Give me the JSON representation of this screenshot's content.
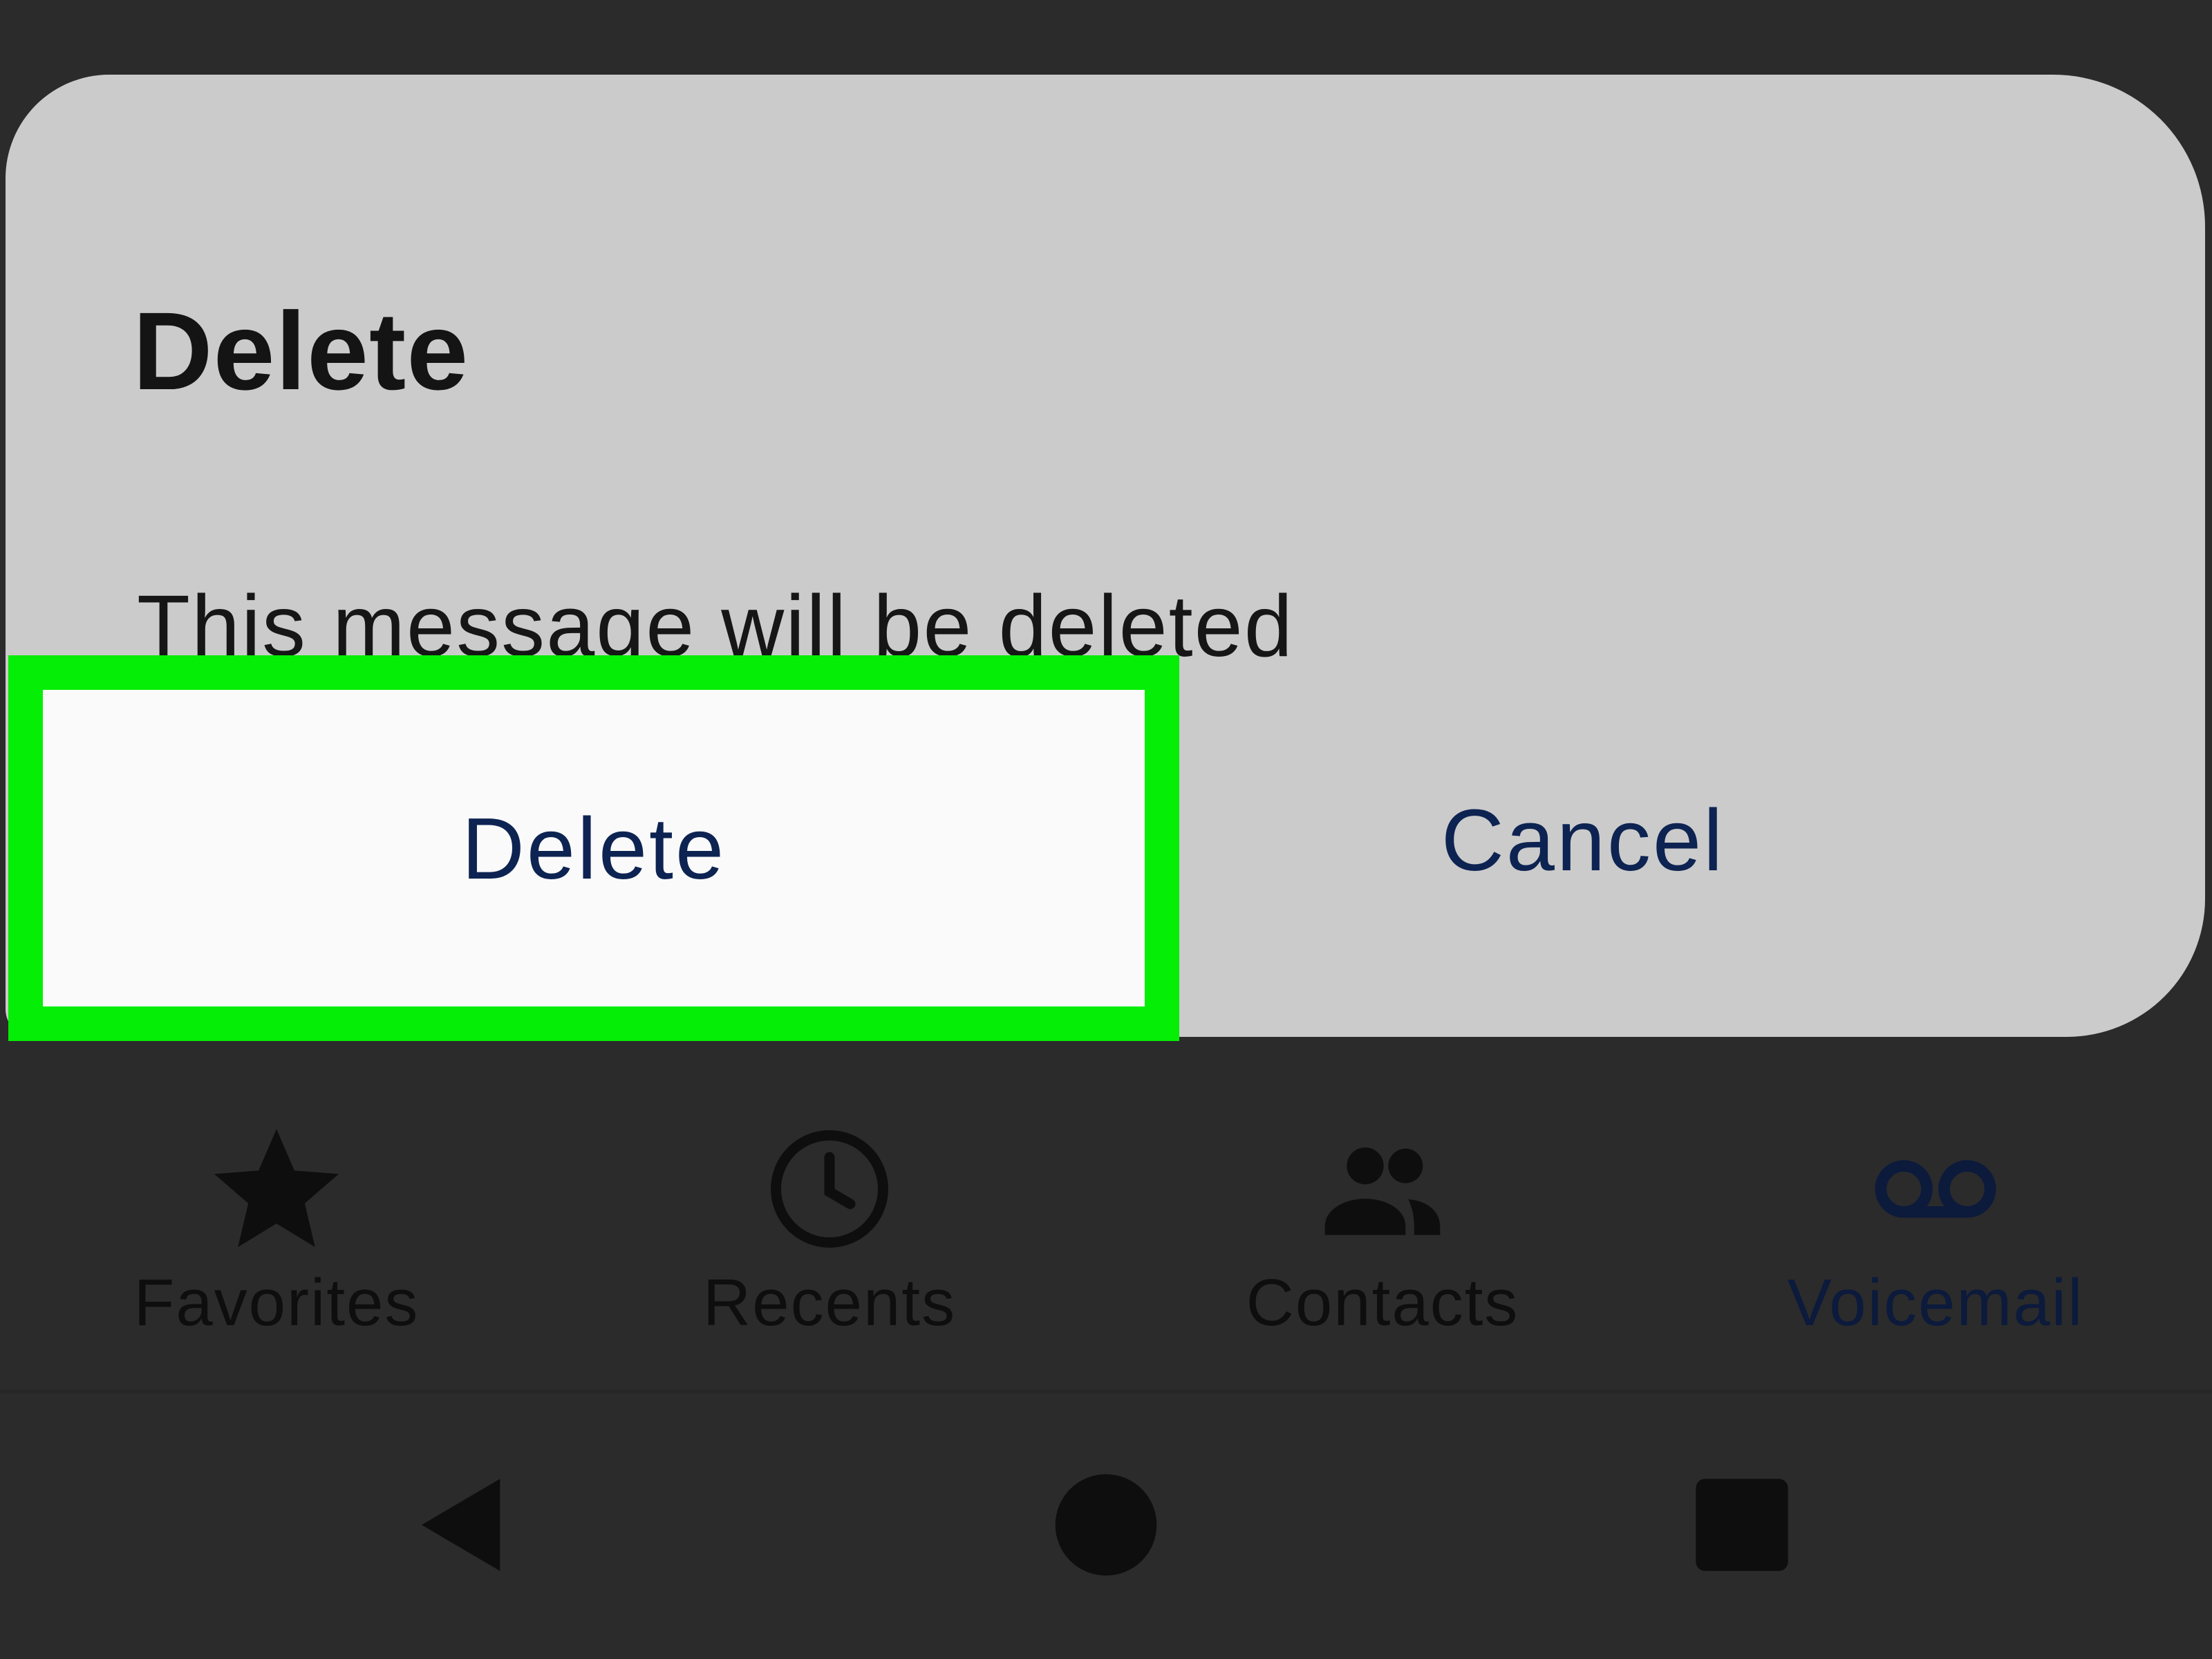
{
  "dialog": {
    "title": "Delete",
    "message": "This message will be deleted",
    "confirm_label": "Delete",
    "cancel_label": "Cancel"
  },
  "tabs": [
    {
      "label": "Favorites",
      "icon": "star-icon"
    },
    {
      "label": "Recents",
      "icon": "clock-icon"
    },
    {
      "label": "Contacts",
      "icon": "people-icon"
    },
    {
      "label": "Voicemail",
      "icon": "voicemail-icon",
      "active": true
    }
  ],
  "navbar": {
    "buttons": [
      "back-icon",
      "home-icon",
      "recents-icon"
    ]
  },
  "colors": {
    "highlight": "#05ee05",
    "dialog_bg": "#cbcbcb",
    "overlay": "#2b2b2b",
    "accent_text": "#0d2352"
  }
}
